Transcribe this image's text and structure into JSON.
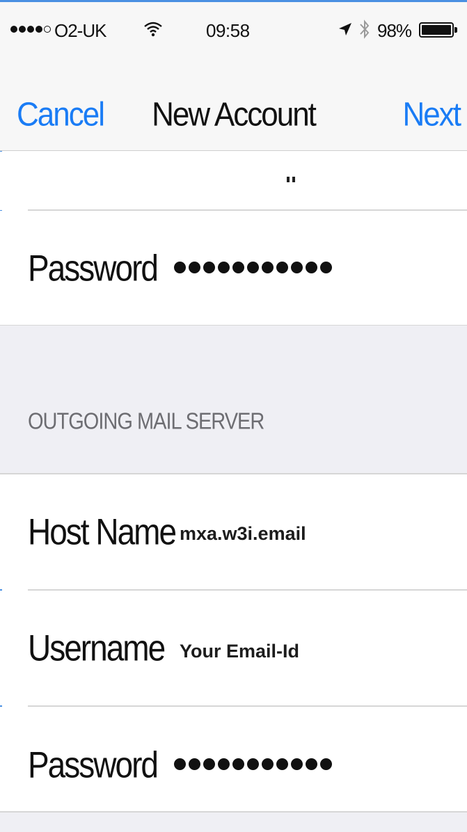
{
  "status_bar": {
    "carrier": "O2-UK",
    "time": "09:58",
    "battery_percent": "98%",
    "signal_bars_filled": 4,
    "signal_bars_total": 5,
    "icons": [
      "wifi-icon",
      "location-arrow-icon",
      "bluetooth-icon",
      "battery-icon"
    ]
  },
  "navbar": {
    "cancel_label": "Cancel",
    "title": "New Account",
    "next_label": "Next"
  },
  "incoming": {
    "password_label": "Password",
    "password_masked": "●●●●●●●●●●●"
  },
  "outgoing": {
    "section_header": "OUTGOING MAIL SERVER",
    "host_label": "Host Name",
    "host_value": "mxa.w3i.email",
    "username_label": "Username",
    "username_value": "Your Email-Id",
    "password_label": "Password",
    "password_masked": "●●●●●●●●●●●"
  },
  "colors": {
    "accent": "#1a7cf5",
    "section_background": "#efeff4",
    "header_text": "#6d6d72"
  }
}
